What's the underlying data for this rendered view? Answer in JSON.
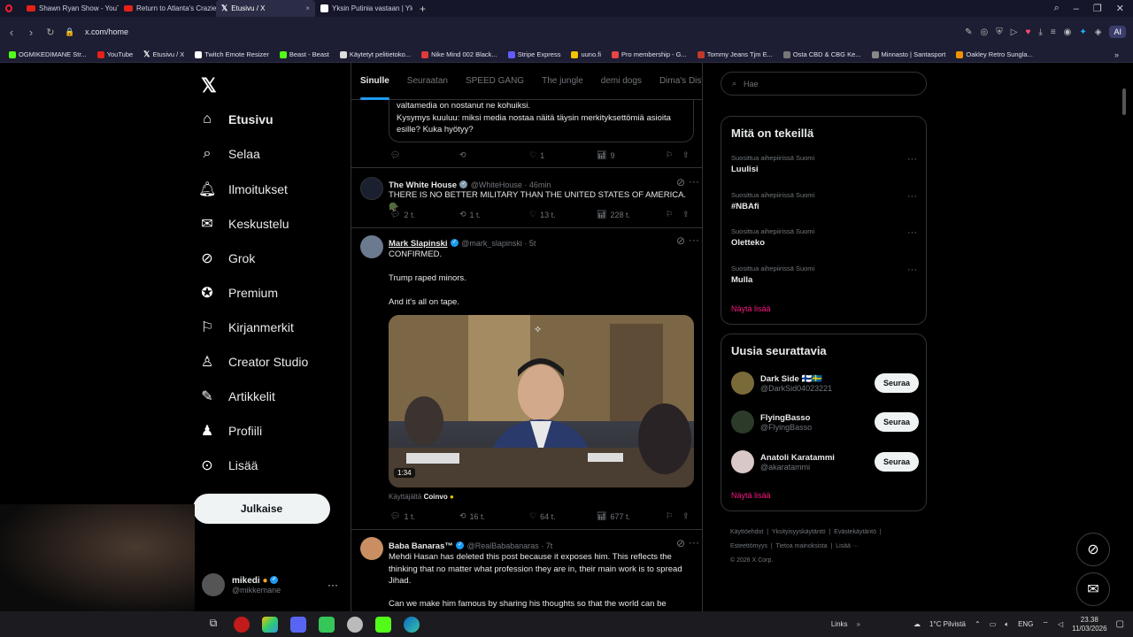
{
  "browser": {
    "tabs": [
      {
        "title": "Shawn Ryan Show - YouTube",
        "icon": "youtube-icon"
      },
      {
        "title": "Return to Atlanta's Crazie",
        "icon": "youtube-icon"
      },
      {
        "title": "Etusivu / X",
        "icon": "x-icon"
      },
      {
        "title": "Yksin Putinia vastaan | Yle",
        "icon": "yle-icon"
      }
    ],
    "url": "x.com/home",
    "ai_label": "AI",
    "bookmarks": [
      "OGMIKEDIMANE Str...",
      "YouTube",
      "Etusivu / X",
      "Twitch Emote Resizer",
      "Beast - Beast",
      "Käytetyt pelitietoko...",
      "Nike Mind 002 Black...",
      "Stripe Express",
      "uuno.fi",
      "Pro membership - G...",
      "Tommy Jeans Tjm E...",
      "Osta CBD & CBG Ke...",
      "Minnasto | Santasport",
      "Oakley Retro Sungla..."
    ]
  },
  "sidebar": {
    "items": [
      {
        "label": "Etusivu",
        "icon": "home-icon"
      },
      {
        "label": "Selaa",
        "icon": "search-icon"
      },
      {
        "label": "Ilmoitukset",
        "icon": "bell-icon"
      },
      {
        "label": "Keskustelu",
        "icon": "mail-icon"
      },
      {
        "label": "Grok",
        "icon": "grok-icon"
      },
      {
        "label": "Premium",
        "icon": "premium-icon"
      },
      {
        "label": "Kirjanmerkit",
        "icon": "bookmark-icon"
      },
      {
        "label": "Creator Studio",
        "icon": "creator-icon"
      },
      {
        "label": "Artikkelit",
        "icon": "article-icon"
      },
      {
        "label": "Profiili",
        "icon": "person-icon"
      },
      {
        "label": "Lisää",
        "icon": "more-icon"
      }
    ],
    "post_label": "Julkaise",
    "account": {
      "name": "mikedi",
      "handle": "@mikkemane"
    }
  },
  "timeline": {
    "tabs": [
      "Sinulle",
      "Seuraatan",
      "SPEED GANG",
      "The jungle",
      "demi dogs",
      "Dima's Dist"
    ],
    "partial_tweet": {
      "text1": "valtamedia on nostanut ne kohuiksi.",
      "text2": "Kysymys kuuluu: miksi media nostaa näitä täysin merkityksettömiä asioita esille? Kuka hyötyy?",
      "likes": "1",
      "views": "9"
    },
    "tweets": [
      {
        "name": "The White House",
        "handle": "@WhiteHouse · 46min",
        "text": "THERE IS NO BETTER MILITARY THAN THE UNITED STATES OF AMERICA. 🪖",
        "replies": "2 t.",
        "reposts": "1 t.",
        "likes": "13 t.",
        "views": "228 t."
      },
      {
        "name": "Mark Slapinski",
        "handle": "@mark_slapinski · 5t",
        "text1": "CONFIRMED.",
        "text2": "Trump raped minors.",
        "text3": "And it's all on tape.",
        "video_duration": "1:34",
        "credit_prefix": "Käyttäjältä",
        "credit_name": "Coinvo",
        "replies": "1 t.",
        "reposts": "16 t.",
        "likes": "64 t.",
        "views": "677 t."
      },
      {
        "name": "Baba Banaras™",
        "handle": "@RealBababanaras · 7t",
        "text1": "Mehdi Hasan has deleted this post because it exposes him. This reflects the thinking that no matter what profession they are in, their main work is to spread Jihad.",
        "text2": "Can we make him famous by sharing his thoughts so that the world can be"
      }
    ]
  },
  "right": {
    "search_placeholder": "Hae",
    "trends_title": "Mitä on tekeillä",
    "trends": [
      {
        "context": "Suosittua aihepiirissä Suomi",
        "title": "Luulisi"
      },
      {
        "context": "Suosittua aihepiirissä Suomi",
        "title": "#NBAfi"
      },
      {
        "context": "Suosittua aihepiirissä Suomi",
        "title": "Oletteko"
      },
      {
        "context": "Suosittua aihepiirissä Suomi",
        "title": "Mulla"
      }
    ],
    "show_more": "Näytä lisää",
    "who_title": "Uusia seurattavia",
    "who": [
      {
        "name": "Dark Side 🇫🇮🇸🇪",
        "handle": "@DarkSid04023221"
      },
      {
        "name": "FlyingBasso",
        "handle": "@FlyingBasso"
      },
      {
        "name": "Anatoli Karatammi",
        "handle": "@akaratammi"
      }
    ],
    "follow_label": "Seuraa",
    "footer": [
      "Käyttöehdot",
      "Yksityisyyskäytäntö",
      "Evästekäytäntö",
      "Esteettömyys",
      "Tietoa mainoksista",
      "Lisää ···",
      "© 2026 X Corp."
    ]
  },
  "taskbar": {
    "links": "Links",
    "weather": "1°C Pilvistä",
    "lang": "ENG",
    "time": "23.38",
    "date": "11/03/2026"
  },
  "colors": {
    "accent": "#1d9bf0",
    "pink": "#f91880",
    "bg": "#000000"
  }
}
